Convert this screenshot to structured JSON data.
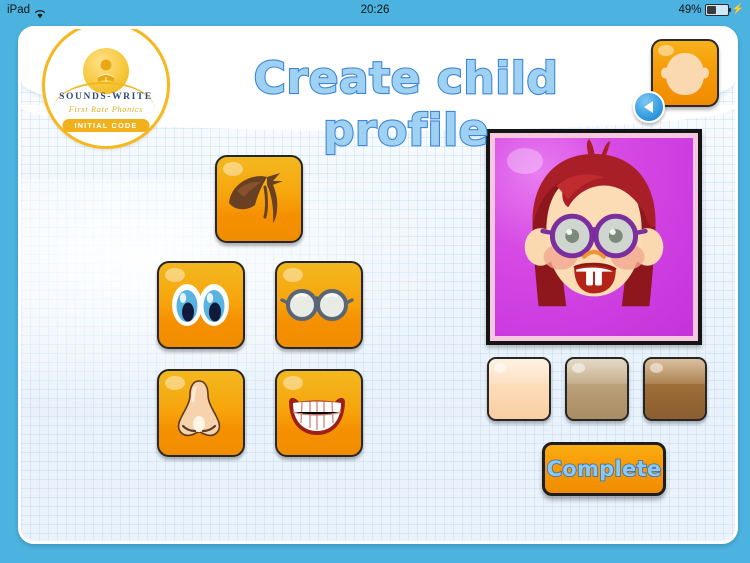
{
  "status_bar": {
    "device": "iPad",
    "wifi_icon": "wifi-icon",
    "time": "20:26",
    "battery_percent": "49%",
    "battery_icon": "battery-icon",
    "charging_icon": "lightning-bolt-icon"
  },
  "logo": {
    "icon": "child-reading-book-icon",
    "brand": "SOUNDS-WRITE",
    "tagline": "First Rate Phonics",
    "badge": "INITIAL CODE"
  },
  "header": {
    "title": "Create child profile",
    "title_fill": "#9fd2f2",
    "title_stroke": "#3f86d6",
    "avatar_thumb_name": "profile-thumbnail",
    "back_icon": "back-arrow-icon"
  },
  "feature_picker": {
    "tiles": [
      {
        "id": "hair",
        "label": "Hair",
        "icon": "hair-icon"
      },
      {
        "id": "eyes",
        "label": "Eyes",
        "icon": "eyes-icon"
      },
      {
        "id": "glasses",
        "label": "Glasses",
        "icon": "glasses-icon"
      },
      {
        "id": "nose",
        "label": "Nose",
        "icon": "nose-icon"
      },
      {
        "id": "mouth",
        "label": "Mouth",
        "icon": "mouth-icon"
      }
    ],
    "tile_color_top": "#f3b81f",
    "tile_color_bottom": "#f08d00"
  },
  "preview": {
    "name": "avatar-preview",
    "background_color": "#cc3ce0",
    "hair_color": "#a81f27",
    "skin_color": "#fbdcb4",
    "glasses_color": "#7b2f9e",
    "frame_color": "#141414"
  },
  "skin_tones": [
    {
      "id": "light",
      "label": "Light skin tone",
      "color": "#fcd9b4"
    },
    {
      "id": "medium",
      "label": "Medium skin tone",
      "color": "#b59a72"
    },
    {
      "id": "dark",
      "label": "Dark skin tone",
      "color": "#9a6a37"
    }
  ],
  "actions": {
    "complete_label": "Complete"
  }
}
